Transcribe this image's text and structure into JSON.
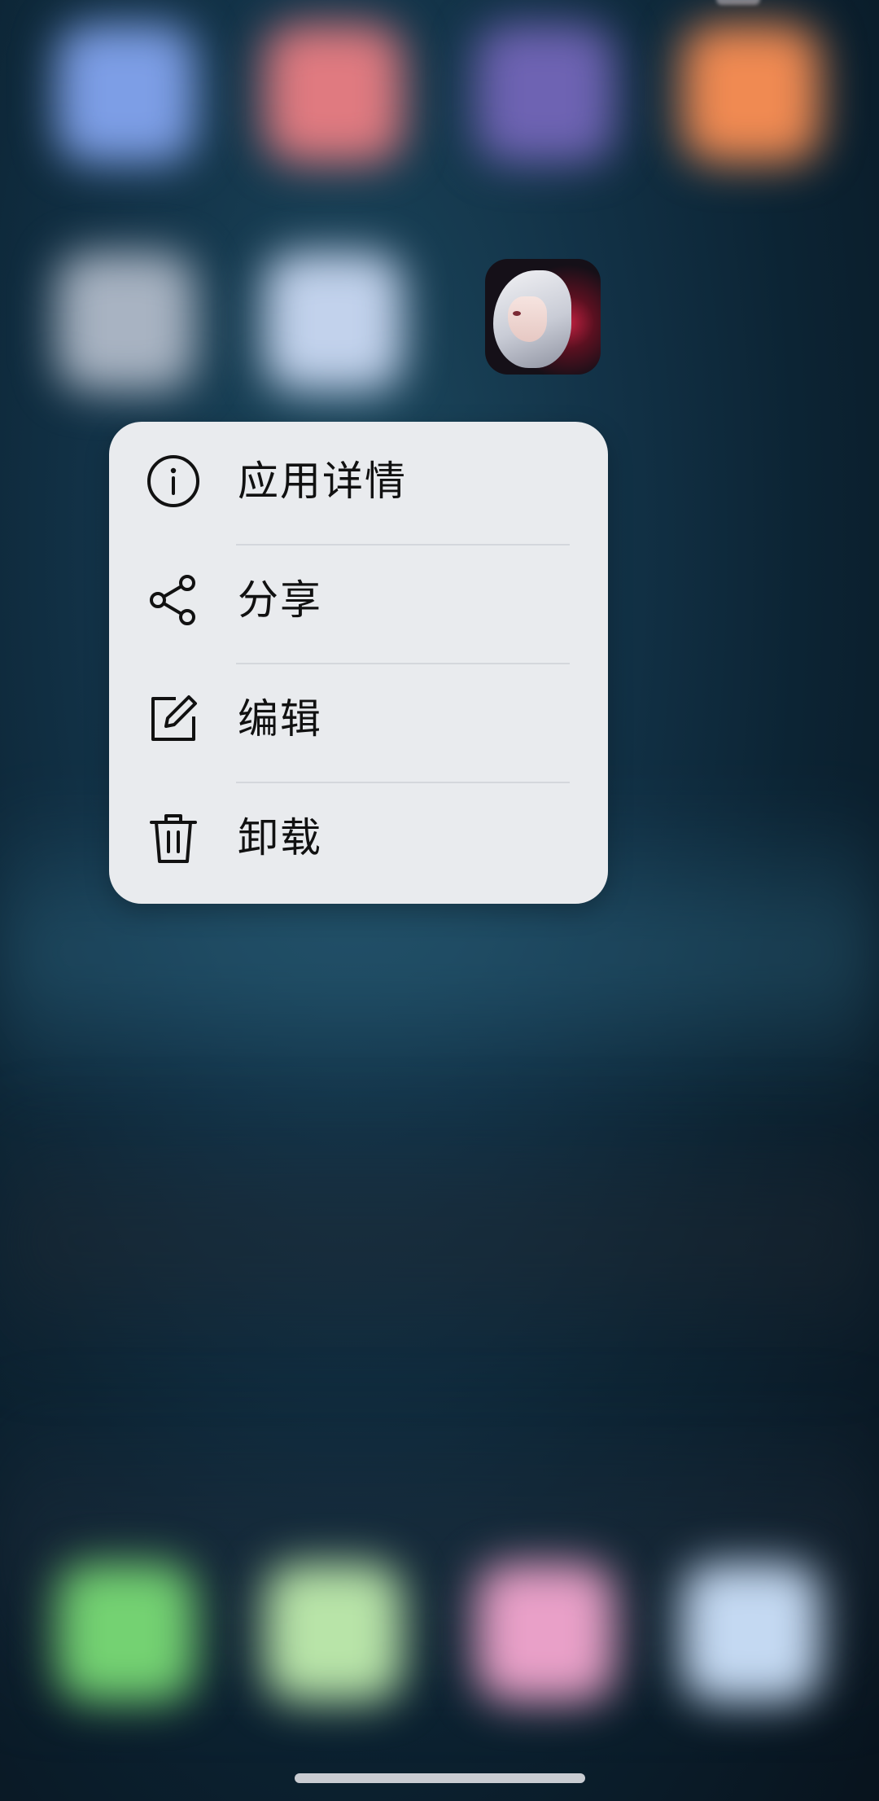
{
  "menu": {
    "items": [
      {
        "label": "应用详情",
        "icon": "info-circle-icon"
      },
      {
        "label": "分享",
        "icon": "share-icon"
      },
      {
        "label": "编辑",
        "icon": "edit-icon"
      },
      {
        "label": "卸载",
        "icon": "trash-icon"
      }
    ]
  },
  "colors": {
    "menu_background": "#e9ebee",
    "text": "#111111",
    "divider": "#d4d7dc",
    "home_indicator": "#c9ccd2"
  }
}
